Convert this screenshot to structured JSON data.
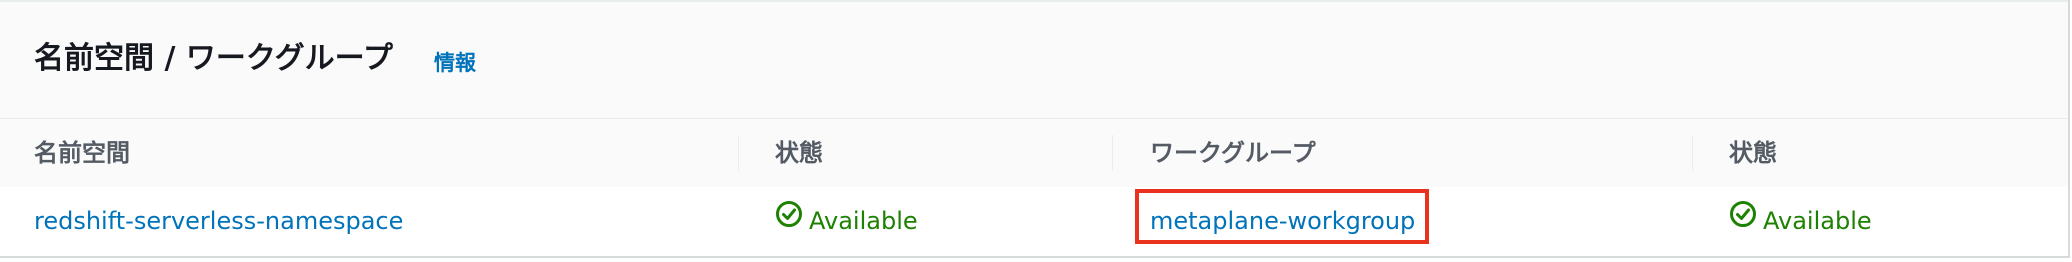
{
  "header": {
    "title": "名前空間 / ワークグループ",
    "info_link": "情報"
  },
  "table": {
    "columns": [
      "名前空間",
      "状態",
      "ワークグループ",
      "状態"
    ],
    "rows": [
      {
        "namespace": "redshift-serverless-namespace",
        "namespace_status": "Available",
        "workgroup": "metaplane-workgroup",
        "workgroup_status": "Available"
      }
    ]
  },
  "colors": {
    "link": "#0073bb",
    "status_available": "#1d8102",
    "highlight_box": "#e8321e"
  },
  "icons": {
    "status": "check-circle-icon"
  }
}
